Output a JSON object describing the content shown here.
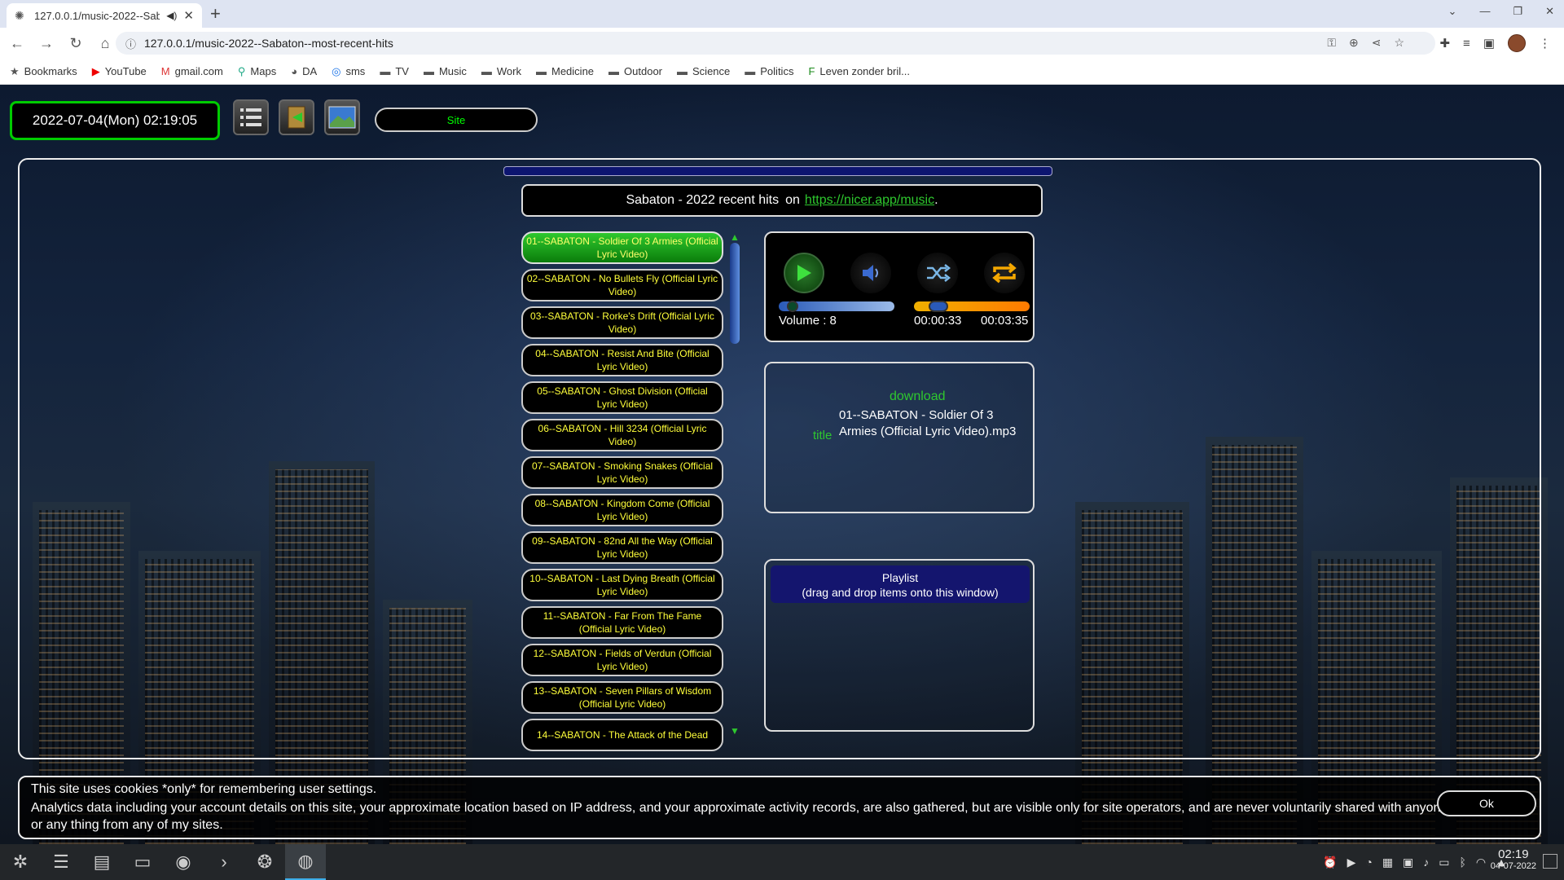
{
  "browser": {
    "tab_title": "127.0.0.1/music-2022--Sab",
    "url": "127.0.0.1/music-2022--Sabaton--most-recent-hits",
    "bookmarks": [
      {
        "label": "Bookmarks",
        "icon": "star-icon"
      },
      {
        "label": "YouTube",
        "icon": "youtube-icon"
      },
      {
        "label": "gmail.com",
        "icon": "gmail-icon"
      },
      {
        "label": "Maps",
        "icon": "maps-icon"
      },
      {
        "label": "DA",
        "icon": "github-icon"
      },
      {
        "label": "sms",
        "icon": "sms-icon"
      },
      {
        "label": "TV",
        "icon": "folder-icon"
      },
      {
        "label": "Music",
        "icon": "folder-icon"
      },
      {
        "label": "Work",
        "icon": "folder-icon"
      },
      {
        "label": "Medicine",
        "icon": "folder-icon"
      },
      {
        "label": "Outdoor",
        "icon": "folder-icon"
      },
      {
        "label": "Science",
        "icon": "folder-icon"
      },
      {
        "label": "Politics",
        "icon": "folder-icon"
      },
      {
        "label": "Leven zonder bril...",
        "icon": "bookmark-f-icon"
      }
    ]
  },
  "page": {
    "datetime": "2022-07-04(Mon) 02:19:05",
    "site_button": "Site",
    "title": {
      "name": "Sabaton - 2022 recent hits",
      "on": "on",
      "link": "https://nicer.app/music",
      "dot": "."
    },
    "tracks": [
      "01--SABATON - Soldier Of 3 Armies (Official Lyric Video)",
      "02--SABATON - No Bullets Fly (Official Lyric Video)",
      "03--SABATON - Rorke's Drift (Official Lyric Video)",
      "04--SABATON - Resist And Bite (Official Lyric Video)",
      "05--SABATON - Ghost Division (Official Lyric Video)",
      "06--SABATON - Hill 3234 (Official Lyric Video)",
      "07--SABATON - Smoking Snakes (Official Lyric Video)",
      "08--SABATON - Kingdom Come (Official Lyric Video)",
      "09--SABATON - 82nd All the Way (Official Lyric Video)",
      "10--SABATON - Last Dying Breath (Official Lyric Video)",
      "11--SABATON - Far From The Fame (Official Lyric Video)",
      "12--SABATON - Fields of Verdun (Official Lyric Video)",
      "13--SABATON - Seven Pillars of Wisdom (Official Lyric Video)",
      "14--SABATON - The Attack of the Dead"
    ],
    "active_track_index": 0,
    "player": {
      "volume_label": "Volume : 8",
      "volume_level": 0.08,
      "time_current": "00:00:33",
      "time_total": "00:03:35",
      "progress": 0.153
    },
    "info": {
      "download": "download",
      "title_label": "title",
      "title_value": "01--SABATON - Soldier Of 3 Armies (Official Lyric Video).mp3"
    },
    "playlist": {
      "line1": "Playlist",
      "line2": "(drag and drop items onto this window)"
    },
    "cookie": {
      "line1": "This site uses cookies *only* for remembering user settings.",
      "line2": "Analytics data including your account details on this site, your approximate location based on IP address, and your approximate activity records, are also gathered, but are visible only for site operators, and are never voluntarily shared with anyone or any thing from any of my sites.",
      "ok": "Ok"
    }
  },
  "taskbar": {
    "time": "02:19",
    "date": "04-07-2022"
  }
}
